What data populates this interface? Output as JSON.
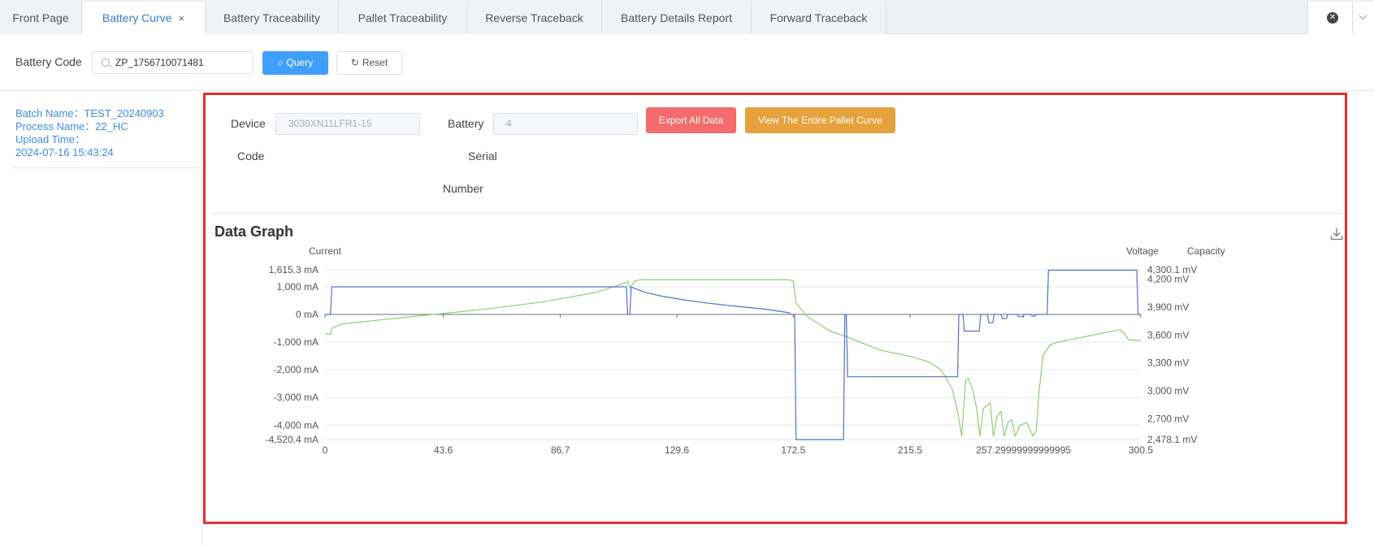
{
  "tabs": [
    {
      "label": "Front Page",
      "active": false
    },
    {
      "label": "Battery Curve",
      "active": true,
      "closable": true
    },
    {
      "label": "Battery Traceability",
      "active": false
    },
    {
      "label": "Pallet Traceability",
      "active": false
    },
    {
      "label": "Reverse Traceback",
      "active": false
    },
    {
      "label": "Battery Details Report",
      "active": false
    },
    {
      "label": "Forward Traceback",
      "active": false
    }
  ],
  "tab_close_glyph": "×",
  "query": {
    "label": "Battery Code",
    "value": "ZP_1756710071481",
    "query_label": "Query",
    "reset_label": "Reset"
  },
  "sidebar": {
    "batch_name_label": "Batch Name：",
    "batch_name": "TEST_20240903",
    "process_name_label": "Process Name：",
    "process_name": "22_HC",
    "upload_time_label": "Upload Time：",
    "upload_time": "2024-07-16 15:43:24"
  },
  "form": {
    "device_label_1": "Device",
    "device_label_2": "Code",
    "device_value": "3030XN11LFR1-15",
    "battery_label_1": "Battery",
    "battery_label_2": "Serial",
    "battery_label_3": "Number",
    "battery_value": "4",
    "export_label": "Export All Data",
    "pallet_label": "View The Entire Pallet Curve"
  },
  "graph": {
    "title": "Data Graph"
  },
  "colors": {
    "current": "#5470c6",
    "voltage": "#91cc75",
    "accent": "#409eff",
    "danger": "#f56c6c",
    "warning": "#e6a23c",
    "highlight": "#e03131"
  },
  "chart_data": {
    "type": "line",
    "title": "",
    "left_axis_label": "Current",
    "right_axis_labels": [
      "Voltage",
      "Capacity"
    ],
    "x_ticks": [
      "0",
      "43.6",
      "86.7",
      "129.6",
      "172.5",
      "215.5",
      "257.29999999999995",
      "300.5"
    ],
    "x_range": [
      0,
      300.5
    ],
    "left_ticks": [
      {
        "v": 1615.3,
        "label": "1,615.3 mA"
      },
      {
        "v": 1000,
        "label": "1,000 mA"
      },
      {
        "v": 0,
        "label": "0 mA"
      },
      {
        "v": -1000,
        "label": "-1,000 mA"
      },
      {
        "v": -2000,
        "label": "-2,000 mA"
      },
      {
        "v": -3000,
        "label": "-3,000 mA"
      },
      {
        "v": -4000,
        "label": "-4,000 mA"
      },
      {
        "v": -4520.4,
        "label": "-4,520.4 mA"
      }
    ],
    "left_range": [
      -4520.4,
      1615.3
    ],
    "right_ticks": [
      {
        "v": 4300.1,
        "label": "4,300.1 mV"
      },
      {
        "v": 4200,
        "label": "4,200 mV"
      },
      {
        "v": 3900,
        "label": "3,900 mV"
      },
      {
        "v": 3600,
        "label": "3,600 mV"
      },
      {
        "v": 3300,
        "label": "3,300 mV"
      },
      {
        "v": 3000,
        "label": "3,000 mV"
      },
      {
        "v": 2700,
        "label": "2,700 mV"
      },
      {
        "v": 2478.1,
        "label": "2,478.1 mV"
      }
    ],
    "right_range": [
      2478.1,
      4300.1
    ],
    "grid": true,
    "series": [
      {
        "name": "Current",
        "axis": "left",
        "points": [
          [
            0,
            0
          ],
          [
            2,
            0
          ],
          [
            2.5,
            1000
          ],
          [
            111,
            1000
          ],
          [
            111.5,
            0
          ],
          [
            112.3,
            0
          ],
          [
            112.8,
            1000
          ],
          [
            114,
            940
          ],
          [
            118,
            800
          ],
          [
            124,
            660
          ],
          [
            132,
            530
          ],
          [
            140,
            420
          ],
          [
            148,
            330
          ],
          [
            156,
            250
          ],
          [
            162,
            190
          ],
          [
            167,
            120
          ],
          [
            171,
            60
          ],
          [
            171.5,
            0
          ],
          [
            173,
            0
          ],
          [
            173.5,
            -4520
          ],
          [
            191,
            -4520
          ],
          [
            191.5,
            0
          ],
          [
            192,
            0
          ],
          [
            192.5,
            -2250
          ],
          [
            233,
            -2250
          ],
          [
            233.5,
            0
          ],
          [
            235,
            0
          ],
          [
            235.5,
            -600
          ],
          [
            241,
            -600
          ],
          [
            241.5,
            0
          ],
          [
            244,
            0
          ],
          [
            244.5,
            -300
          ],
          [
            246,
            -300
          ],
          [
            246.5,
            0
          ],
          [
            249,
            0
          ],
          [
            249.5,
            -150
          ],
          [
            251,
            -150
          ],
          [
            251.5,
            0
          ],
          [
            255,
            0
          ],
          [
            255.5,
            -80
          ],
          [
            257,
            -80
          ],
          [
            257.5,
            0
          ],
          [
            260,
            0
          ],
          [
            260.5,
            -60
          ],
          [
            261.5,
            -60
          ],
          [
            262,
            0
          ],
          [
            266,
            0
          ],
          [
            266.5,
            1600
          ],
          [
            299,
            1600
          ],
          [
            299.5,
            0
          ],
          [
            300.5,
            0
          ]
        ]
      },
      {
        "name": "Voltage",
        "axis": "left",
        "points": [
          [
            0,
            -700
          ],
          [
            2,
            -720
          ],
          [
            2.5,
            -500
          ],
          [
            6,
            -350
          ],
          [
            20,
            -200
          ],
          [
            40,
            0
          ],
          [
            60,
            200
          ],
          [
            80,
            450
          ],
          [
            100,
            800
          ],
          [
            111,
            1150
          ],
          [
            111.6,
            1200
          ],
          [
            112.3,
            950
          ],
          [
            114,
            1200
          ],
          [
            116,
            1250
          ],
          [
            171,
            1250
          ],
          [
            172.5,
            1200
          ],
          [
            173.5,
            400
          ],
          [
            178,
            -100
          ],
          [
            186,
            -600
          ],
          [
            192,
            -800
          ],
          [
            197,
            -1000
          ],
          [
            205,
            -1300
          ],
          [
            215,
            -1500
          ],
          [
            222,
            -1700
          ],
          [
            227,
            -2000
          ],
          [
            231,
            -2700
          ],
          [
            233,
            -3500
          ],
          [
            234.5,
            -4400
          ],
          [
            236,
            -2400
          ],
          [
            237,
            -2300
          ],
          [
            238.5,
            -2700
          ],
          [
            240,
            -3400
          ],
          [
            241.2,
            -4400
          ],
          [
            242.5,
            -3400
          ],
          [
            245,
            -3200
          ],
          [
            246.2,
            -4400
          ],
          [
            247.5,
            -3700
          ],
          [
            249,
            -3500
          ],
          [
            250.2,
            -4400
          ],
          [
            251.5,
            -3900
          ],
          [
            253,
            -3800
          ],
          [
            254.2,
            -4400
          ],
          [
            256,
            -4000
          ],
          [
            258.5,
            -3900
          ],
          [
            260.8,
            -4400
          ],
          [
            262,
            -4200
          ],
          [
            263,
            -2800
          ],
          [
            264.5,
            -1500
          ],
          [
            267,
            -1100
          ],
          [
            270,
            -1000
          ],
          [
            275,
            -900
          ],
          [
            285,
            -700
          ],
          [
            293,
            -550
          ],
          [
            294.5,
            -700
          ],
          [
            296,
            -920
          ],
          [
            300.5,
            -940
          ]
        ]
      }
    ]
  }
}
